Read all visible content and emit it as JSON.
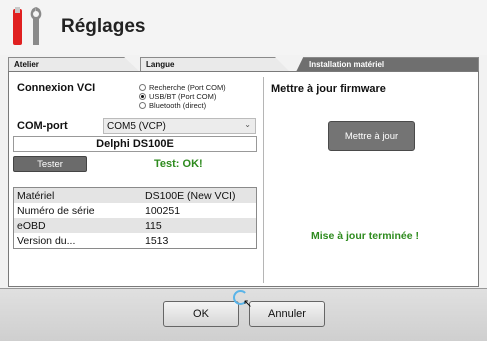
{
  "header": {
    "title": "Réglages",
    "icon": "tools-icon"
  },
  "tabs": [
    {
      "label": "Atelier",
      "active": false
    },
    {
      "label": "Langue",
      "active": false
    },
    {
      "label": "Installation matériel",
      "active": true
    }
  ],
  "connexion": {
    "label": "Connexion VCI",
    "options": [
      {
        "label": "Recherche (Port COM)",
        "selected": false
      },
      {
        "label": "USB/BT (Port COM)",
        "selected": true
      },
      {
        "label": "Bluetooth (direct)",
        "selected": false
      }
    ]
  },
  "com_port": {
    "label": "COM-port",
    "value": "COM5 (VCP)"
  },
  "device_name": "Delphi DS100E",
  "test": {
    "button_label": "Tester",
    "status": "Test: OK!"
  },
  "info": [
    {
      "key": "Matériel",
      "value": "DS100E (New VCI)"
    },
    {
      "key": "Numéro de série",
      "value": "100251"
    },
    {
      "key": "eOBD",
      "value": "115"
    },
    {
      "key": "Version du...",
      "value": "1513"
    }
  ],
  "firmware": {
    "title": "Mettre à jour firmware",
    "button_label": "Mettre à jour",
    "status": "Mise à jour terminée !"
  },
  "footer": {
    "ok_label": "OK",
    "cancel_label": "Annuler"
  },
  "colors": {
    "success": "#2e8b1e",
    "active_tab": "#6f6f6f",
    "spinner": "#5ab4e8"
  }
}
